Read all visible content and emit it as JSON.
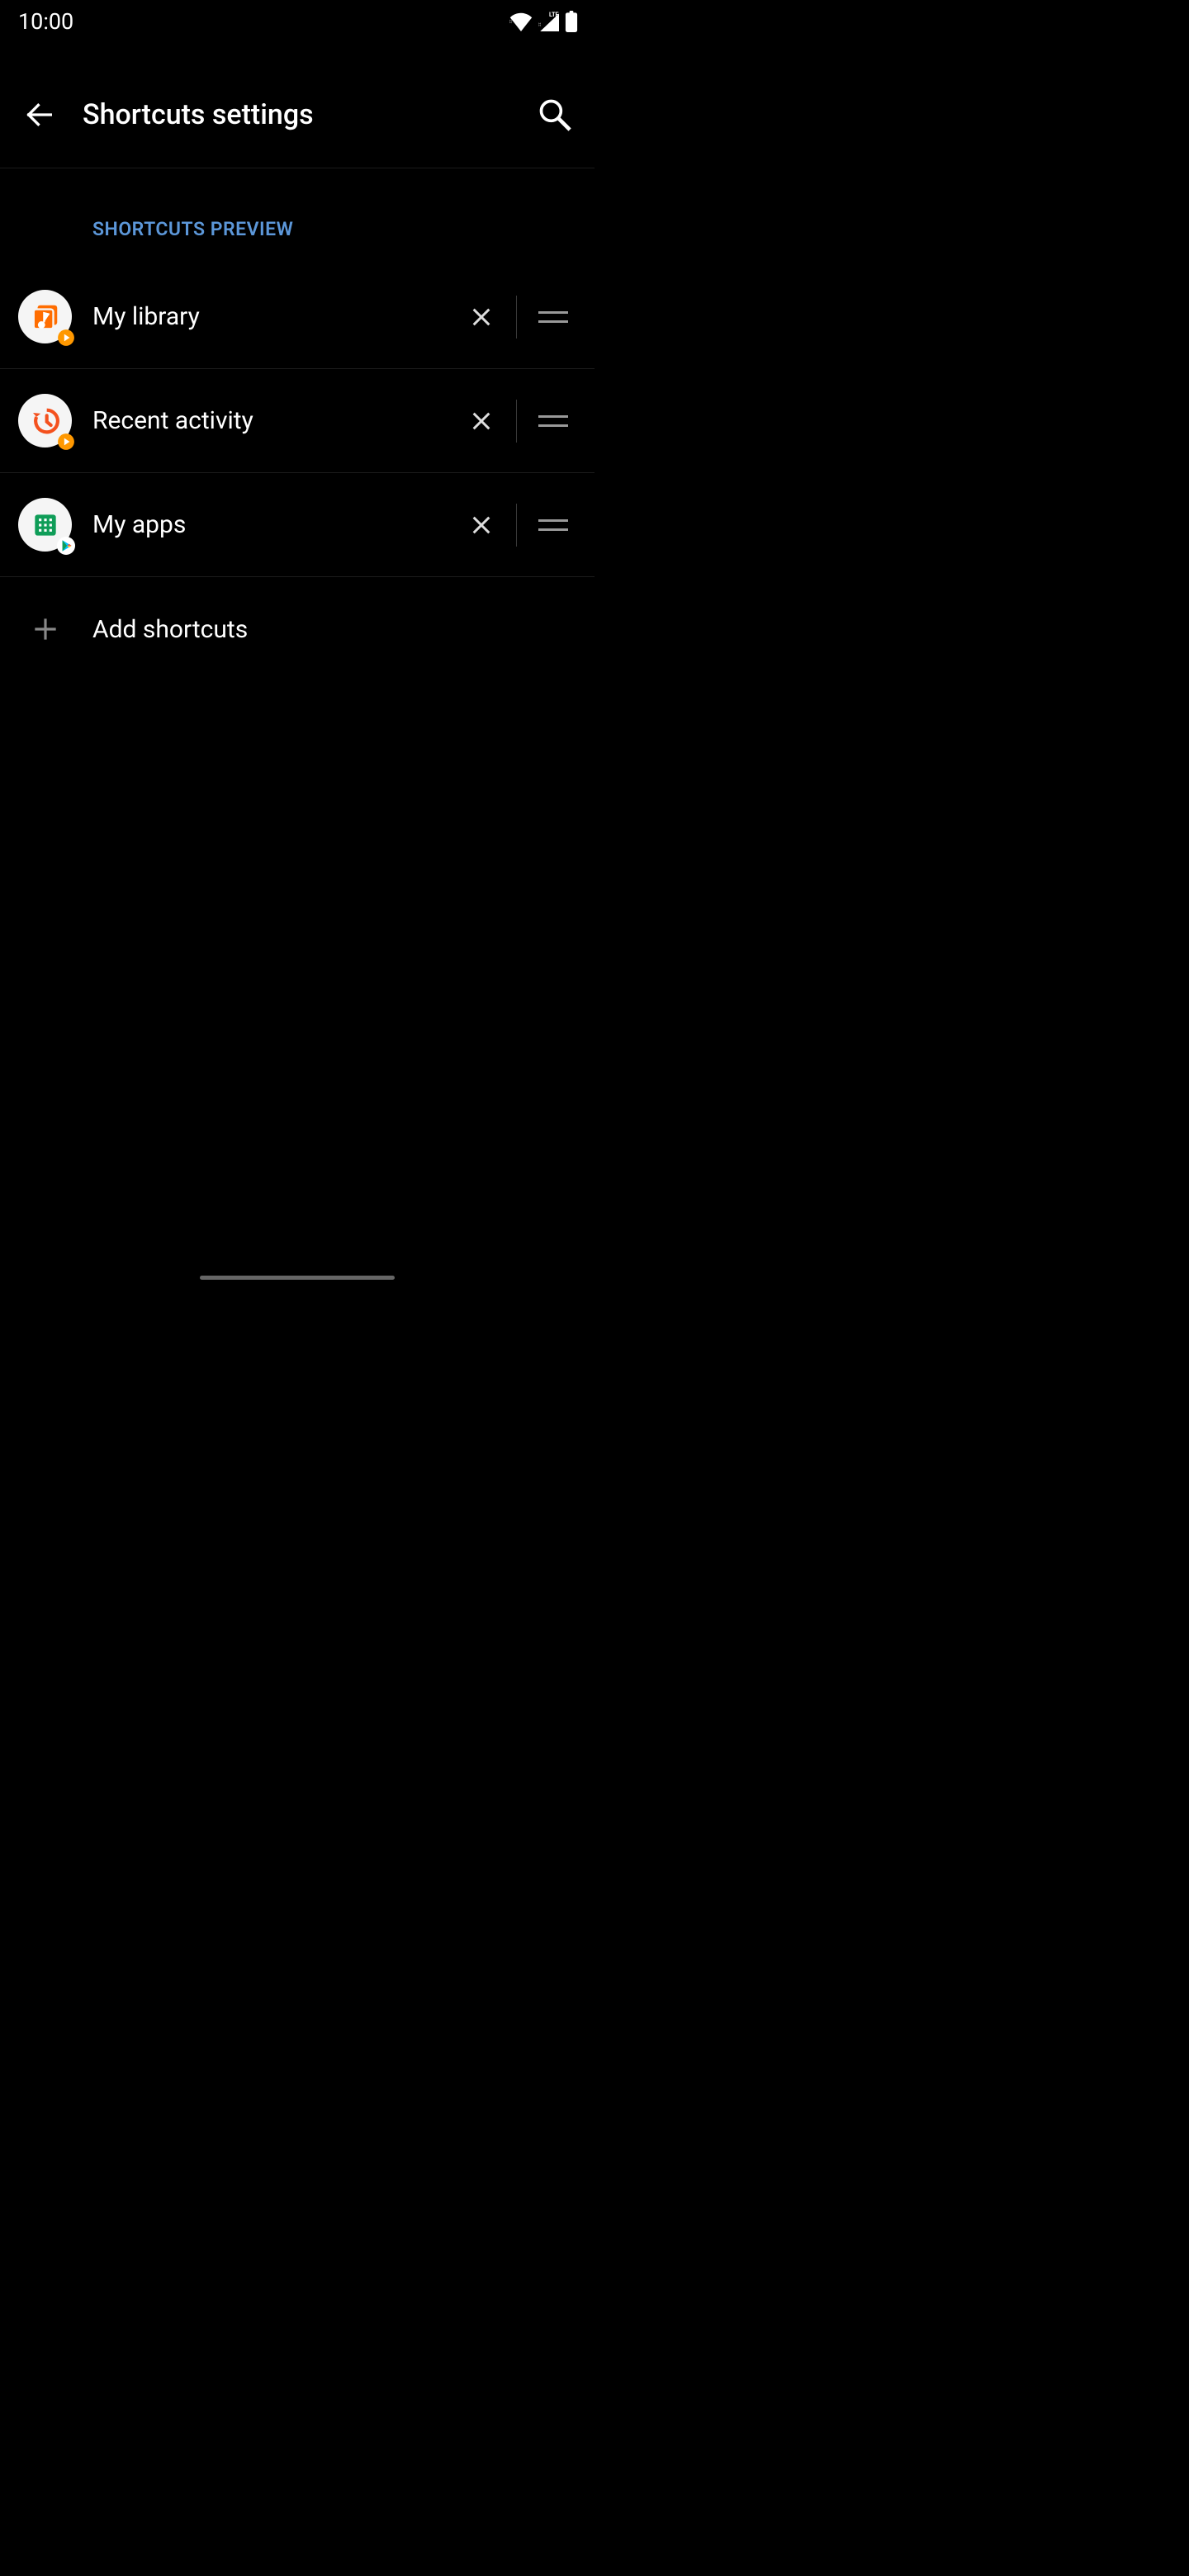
{
  "status": {
    "time": "10:00",
    "network": "LTE"
  },
  "header": {
    "title": "Shortcuts settings"
  },
  "section": {
    "label": "SHORTCUTS PREVIEW"
  },
  "shortcuts": [
    {
      "label": "My library",
      "icon": "library",
      "color": "#ff6d00",
      "badge": "play-music"
    },
    {
      "label": "Recent activity",
      "icon": "history",
      "color": "#f4511e",
      "badge": "play-music"
    },
    {
      "label": "My apps",
      "icon": "apps-grid",
      "color": "#0f9d58",
      "badge": "play-store"
    }
  ],
  "add": {
    "label": "Add shortcuts"
  }
}
